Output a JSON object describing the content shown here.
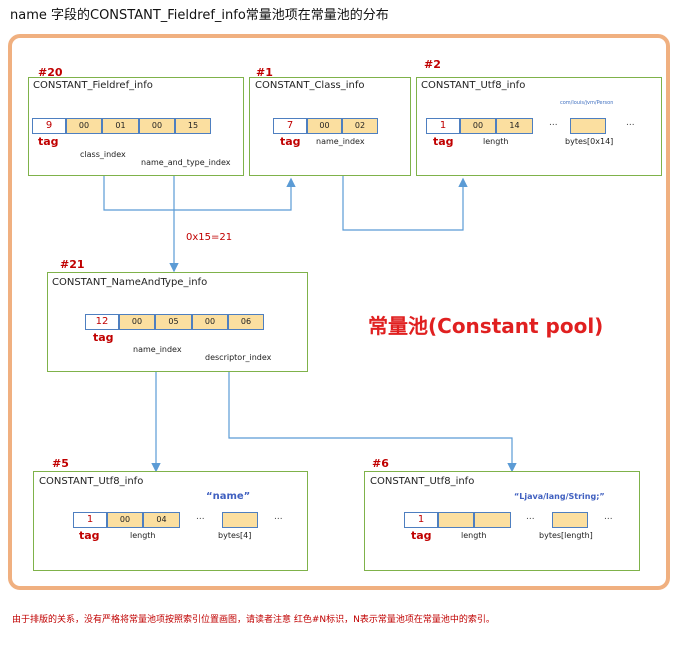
{
  "title": "name 字段的CONSTANT_Fieldref_info常量池项在常量池的分布",
  "pool_label": "常量池(Constant pool)",
  "offset_label": "0x15=21",
  "tag_text": "tag",
  "ellipsis": "...",
  "entries": {
    "fieldref": {
      "index": "#20",
      "name": "CONSTANT_Fieldref_info",
      "cells": [
        "9",
        "00",
        "01",
        "00",
        "15"
      ],
      "labels": [
        "class_index",
        "name_and_type_index"
      ]
    },
    "class": {
      "index": "#1",
      "name": "CONSTANT_Class_info",
      "cells": [
        "7",
        "00",
        "02"
      ],
      "labels": [
        "name_index"
      ]
    },
    "utf8_2": {
      "index": "#2",
      "name": "CONSTANT_Utf8_info",
      "string": "com/louis/jvm/Person",
      "cells": [
        "1",
        "00",
        "14"
      ],
      "labels": [
        "length",
        "bytes[0x14]"
      ]
    },
    "nat": {
      "index": "#21",
      "name": "CONSTANT_NameAndType_info",
      "cells": [
        "12",
        "00",
        "05",
        "00",
        "06"
      ],
      "labels": [
        "name_index",
        "descriptor_index"
      ]
    },
    "utf8_5": {
      "index": "#5",
      "name": "CONSTANT_Utf8_info",
      "string": "“name”",
      "cells": [
        "1",
        "00",
        "04"
      ],
      "labels": [
        "length",
        "bytes[4]"
      ]
    },
    "utf8_6": {
      "index": "#6",
      "name": "CONSTANT_Utf8_info",
      "string": "“Ljava/lang/String;”",
      "cells": [
        "1",
        "",
        ""
      ],
      "labels": [
        "length",
        "bytes[length]"
      ]
    }
  },
  "note": "由于排版的关系，没有严格将常量池项按照索引位置画图，请读者注意 红色#N标识，N表示常量池项在常量池中的索引。",
  "colors": {
    "border": "#f0b080",
    "box": "#7fb24a",
    "cell_fill": "#fbdfa0",
    "cell_border": "#4e7fc0",
    "arrow": "#5b9bd5",
    "red": "#c00000"
  }
}
